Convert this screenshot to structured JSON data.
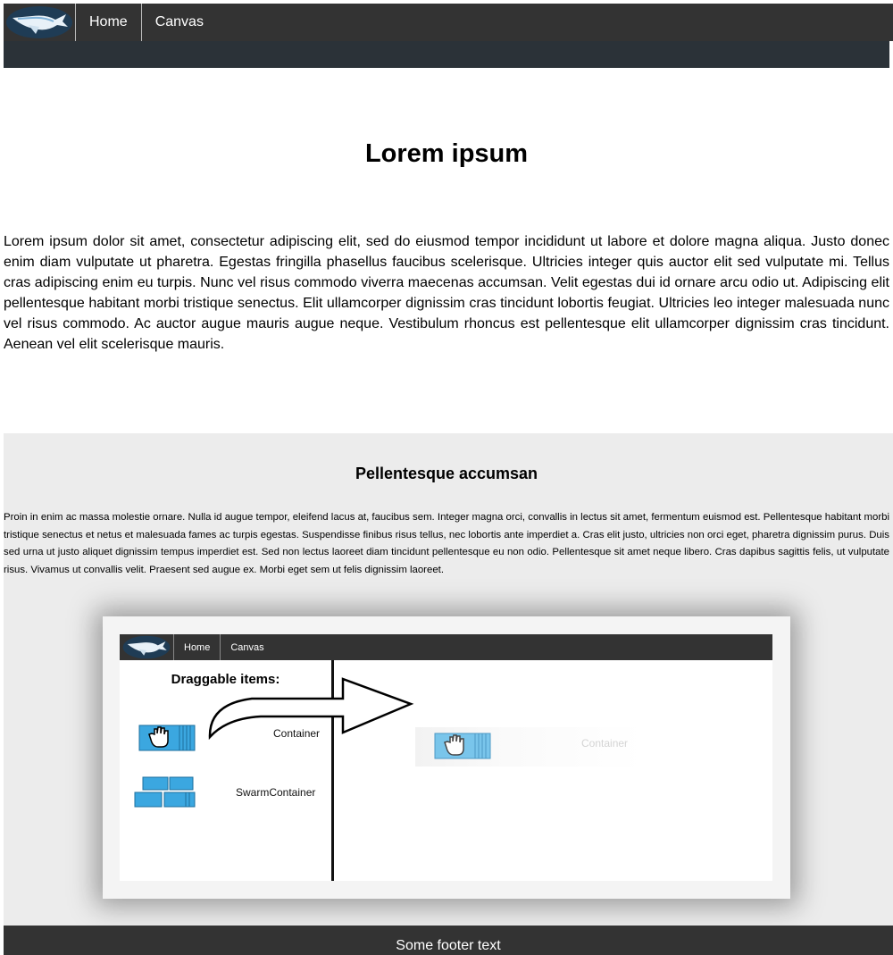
{
  "nav": {
    "logo": "whale-logo",
    "links": [
      "Home",
      "Canvas"
    ]
  },
  "hero": {
    "title": "Lorem ipsum",
    "paragraph": "Lorem ipsum dolor sit amet, consectetur adipiscing elit, sed do eiusmod tempor incididunt ut labore et dolore magna aliqua. Justo donec enim diam vulputate ut pharetra. Egestas fringilla phasellus faucibus scelerisque. Ultricies integer quis auctor elit sed vulputate mi. Tellus cras adipiscing enim eu turpis. Nunc vel risus commodo viverra maecenas accumsan. Velit egestas dui id ornare arcu odio ut. Adipiscing elit pellentesque habitant morbi tristique senectus. Elit ullamcorper dignissim cras tincidunt lobortis feugiat. Ultricies leo integer malesuada nunc vel risus commodo. Ac auctor augue mauris augue neque. Vestibulum rhoncus est pellentesque elit ullamcorper dignissim cras tincidunt. Aenean vel elit scelerisque mauris."
  },
  "section": {
    "title": "Pellentesque accumsan",
    "paragraph": "Proin in enim ac massa molestie ornare. Nulla id augue tempor, eleifend lacus at, faucibus sem. Integer magna orci, convallis in lectus sit amet, fermentum euismod est. Pellentesque habitant morbi tristique senectus et netus et malesuada fames ac turpis egestas. Suspendisse finibus risus tellus, nec lobortis ante imperdiet a. Cras elit justo, ultricies non orci eget, pharetra dignissim purus. Duis sed urna ut justo aliquet dignissim tempus imperdiet est. Sed non lectus laoreet diam tincidunt pellentesque eu non odio. Pellentesque sit amet neque libero. Cras dapibus sagittis felis, ut vulputate risus. Vivamus ut convallis velit. Praesent sed augue ex. Morbi eget sem ut felis dignissim laoreet."
  },
  "illustration": {
    "nav_links": [
      "Home",
      "Canvas"
    ],
    "draggable_title": "Draggable items:",
    "items": [
      {
        "label": "Container",
        "icon": "container-icon"
      },
      {
        "label": "SwarmContainer",
        "icon": "swarm-container-icon"
      }
    ],
    "dropped_label": "Container"
  },
  "footer": {
    "text": "Some footer text"
  },
  "colors": {
    "navbar": "#333333",
    "nav_strip": "#2b3238",
    "section_bg": "#ececec",
    "container_blue": "#3ba7e0"
  }
}
